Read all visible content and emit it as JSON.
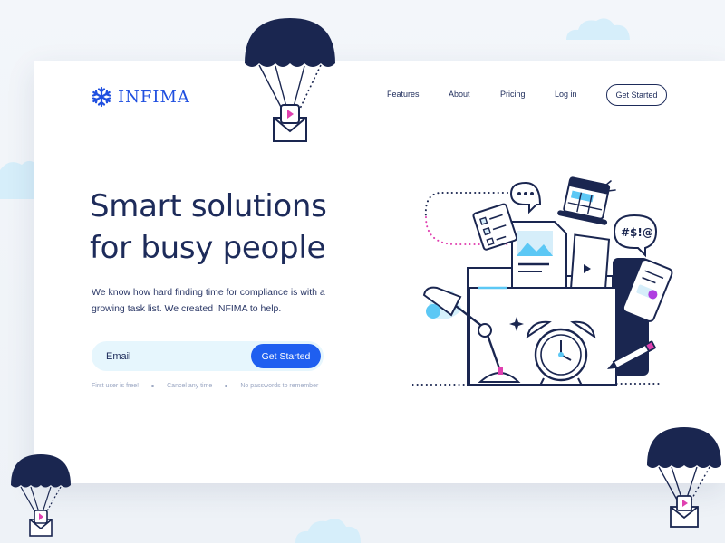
{
  "brand": {
    "name": "INFIMA",
    "accent": "#1f5ff0",
    "navy": "#1d2b5a"
  },
  "nav": {
    "links": [
      "Features",
      "About",
      "Pricing",
      "Log in"
    ],
    "cta": "Get Started"
  },
  "hero": {
    "headline_line1": "Smart solutions",
    "headline_line2": "for busy people",
    "subtext_line1": "We know how hard finding time for compliance is with a",
    "subtext_line2": "growing task list. We created INFIMA to help.",
    "email_placeholder": "Email",
    "form_cta": "Get Started",
    "perks": [
      "First user is free!",
      "Cancel any time",
      "No passwords to remember"
    ]
  },
  "illustration": {
    "chat_bubble_text": "#$!@",
    "icons": [
      "chat-bubble-icon",
      "calendar-icon",
      "checklist-icon",
      "document-icon",
      "folder-icon",
      "phone-icon",
      "desk-lamp-icon",
      "alarm-clock-icon",
      "pencil-icon",
      "sparkle-icon"
    ]
  },
  "decor": {
    "parachute_envelopes": 3
  }
}
